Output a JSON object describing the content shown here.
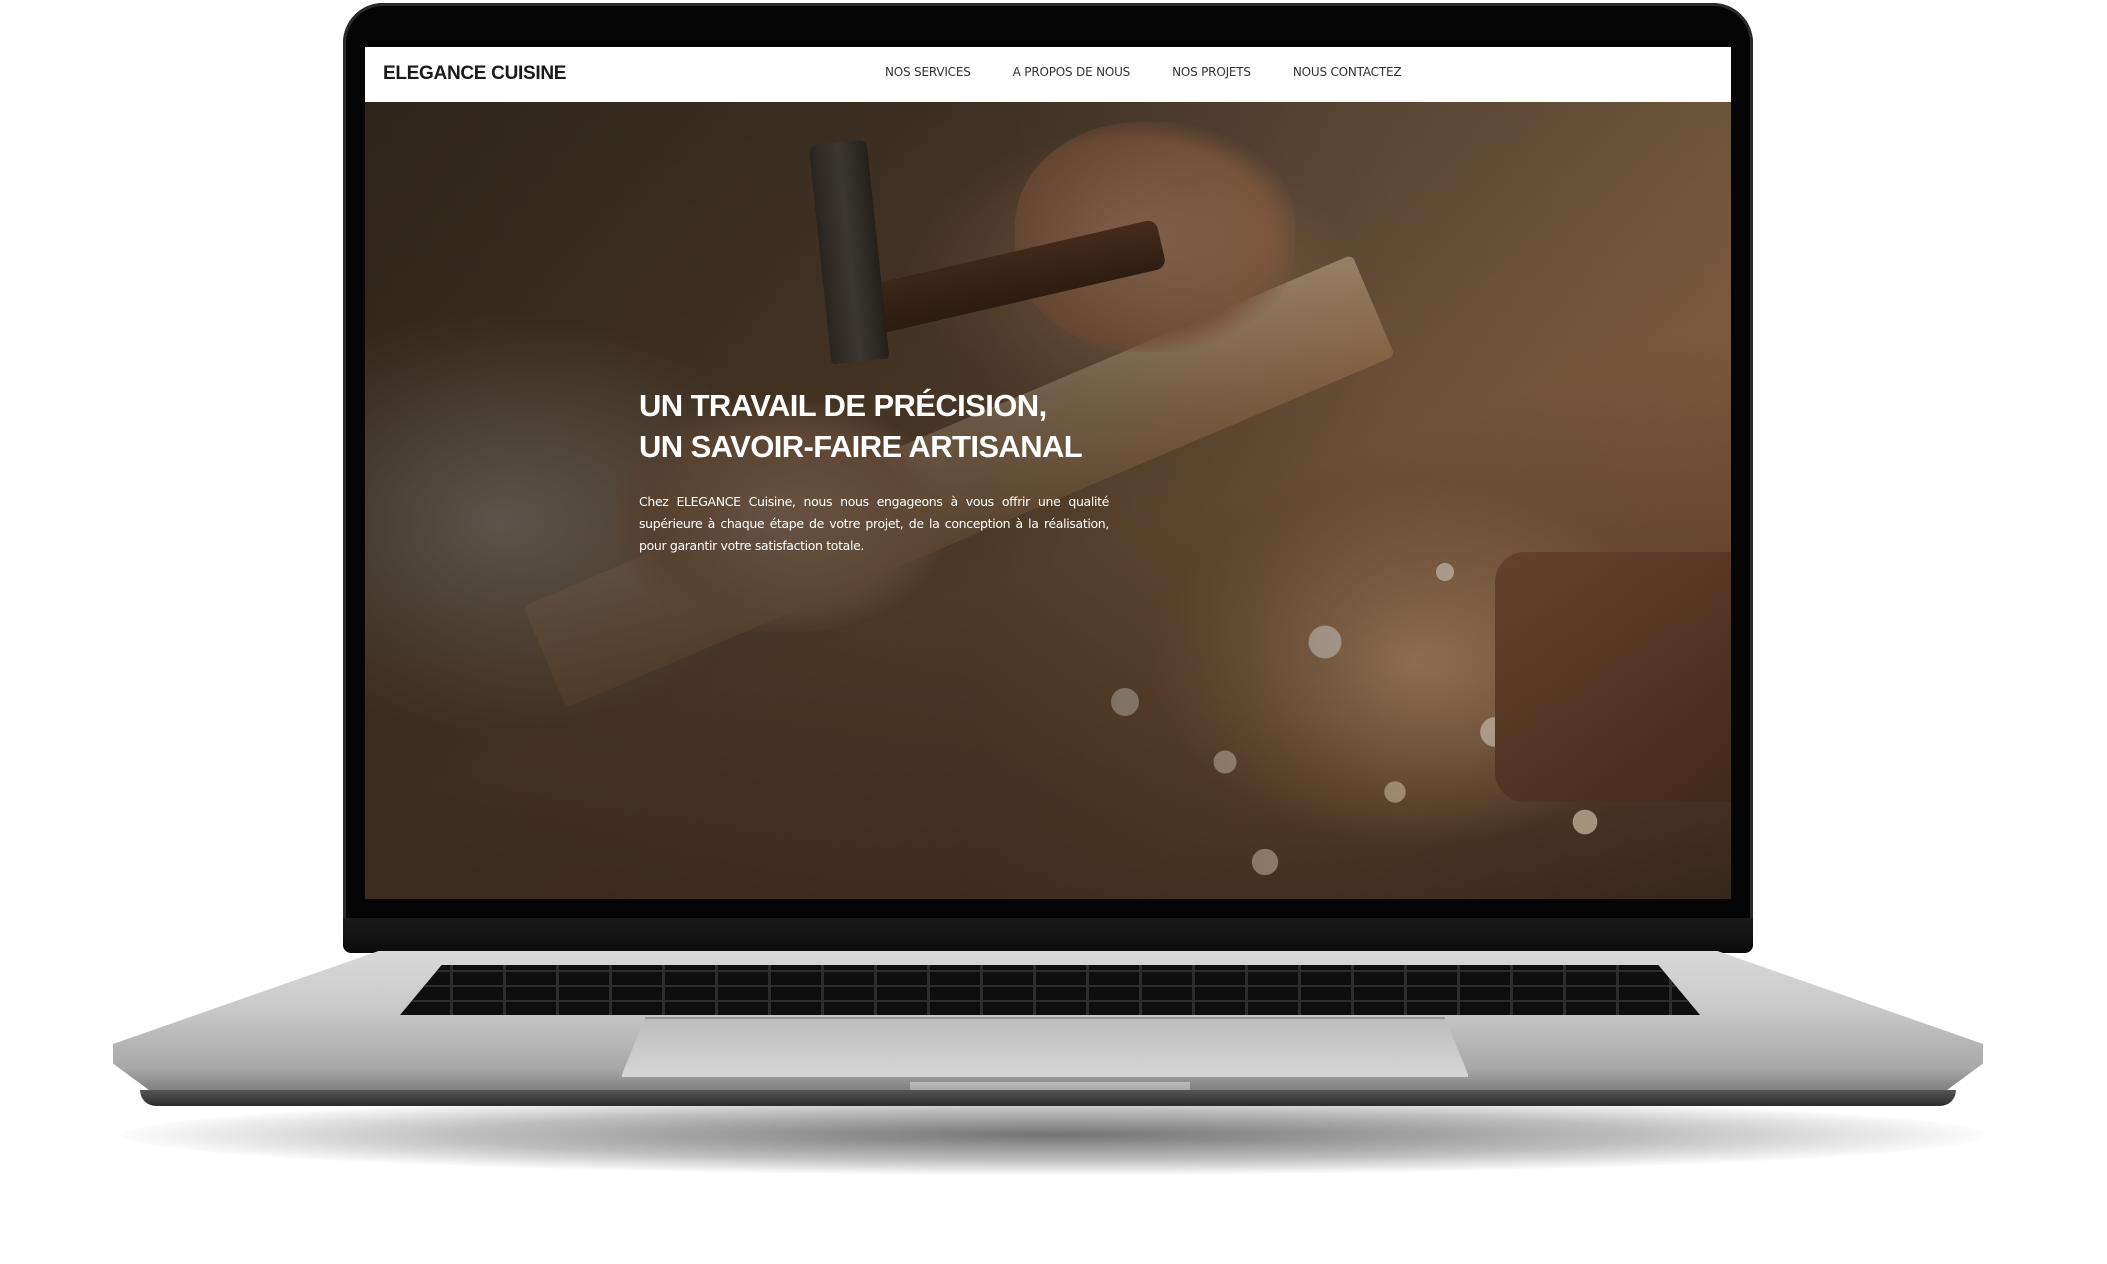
{
  "site": {
    "brand": "ELEGANCE CUISINE"
  },
  "nav": {
    "items": [
      {
        "label": "NOS SERVICES"
      },
      {
        "label": "A PROPOS DE NOUS"
      },
      {
        "label": "NOS PROJETS"
      },
      {
        "label": "NOUS CONTACTEZ"
      }
    ]
  },
  "hero": {
    "title_line1": "UN TRAVAIL DE PRÉCISION,",
    "title_line2": "UN SAVOIR-FAIRE ARTISANAL",
    "description": "Chez ELEGANCE Cuisine, nous nous engageons à vous offrir une qualité supérieure à chaque étape de votre projet, de la conception à la réalisation, pour garantir votre satisfaction totale.",
    "background_image": "carpenter-hammer-chisel-workbench"
  },
  "colors": {
    "navbar_bg": "#ffffff",
    "brand_text": "#1a1a1a",
    "nav_text": "#333333",
    "hero_text": "#ffffff",
    "laptop_bezel": "#050505",
    "laptop_body": "#c8c8c8"
  }
}
